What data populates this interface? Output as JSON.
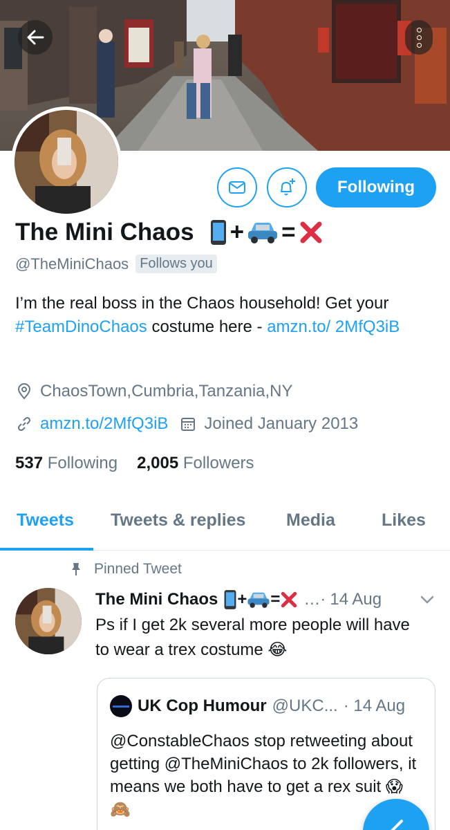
{
  "profile": {
    "name": "The Mini Chaos",
    "name_suffix_plus": "+",
    "name_suffix_equals": "=",
    "handle": "@TheMiniChaos",
    "follows_you": "Follows you",
    "bio_pre": "I’m the real boss in the Chaos household! Get your ",
    "bio_hashtag": "#TeamDinoChaos",
    "bio_mid": " costume here - ",
    "bio_link": "amzn.to/ 2MfQ3iB",
    "location": "ChaosTown,Cumbria,Tanzania,NY",
    "website": "amzn.to/2MfQ3iB",
    "joined": "Joined January 2013",
    "following_count": "537",
    "following_label": "Following",
    "followers_count": "2,005",
    "followers_label": "Followers"
  },
  "actions": {
    "following_button": "Following"
  },
  "tabs": [
    "Tweets",
    "Tweets & replies",
    "Media",
    "Likes"
  ],
  "active_tab": "Tweets",
  "tweet": {
    "pinned_label": "Pinned Tweet",
    "author": "The Mini Chaos",
    "ellipsis": "…·",
    "date": "14 Aug",
    "text": "Ps if I get 2k several more people will have to wear a trex costume 😂",
    "quote": {
      "author": "UK Cop Humour",
      "handle": "@UKC...",
      "date": "· 14 Aug",
      "text": "@ConstableChaos stop retweeting about getting @TheMiniChaos to 2k followers, it means we both have to get a rex suit 😱🙈"
    }
  },
  "colors": {
    "accent": "#1da1f2",
    "secondary_text": "#657786",
    "cross": "#dd2e44"
  },
  "icons": [
    "back-arrow-icon",
    "more-icon",
    "mail-icon",
    "bell-plus-icon",
    "location-pin-icon",
    "link-icon",
    "calendar-icon",
    "pin-icon",
    "chevron-down-icon",
    "compose-icon"
  ]
}
